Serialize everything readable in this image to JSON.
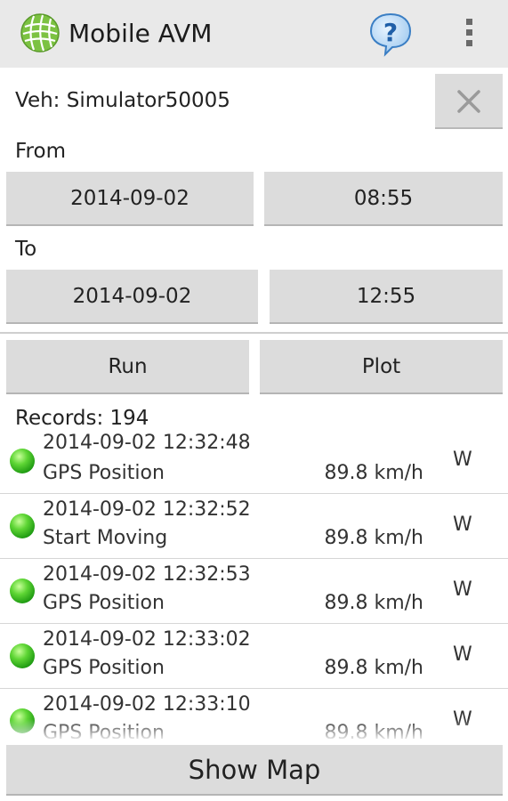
{
  "action_bar": {
    "title": "Mobile AVM",
    "app_icon": "globe-icon",
    "help_icon": "help-bubble-icon",
    "menu_icon": "overflow-menu-icon"
  },
  "vehicle": {
    "label": "Veh: Simulator50005",
    "clear_icon": "close-icon"
  },
  "from": {
    "label": "From",
    "date": "2014-09-02",
    "time": "08:55"
  },
  "to": {
    "label": "To",
    "date": "2014-09-02",
    "time": "12:55"
  },
  "actions": {
    "run": "Run",
    "plot": "Plot"
  },
  "records": {
    "count_label": "Records: 194",
    "status_color": "#3cc324",
    "items": [
      {
        "time": "2014-09-02 12:32:48",
        "event": "GPS Position",
        "speed": "89.8 km/h",
        "direction": "W"
      },
      {
        "time": "2014-09-02 12:32:52",
        "event": "Start Moving",
        "speed": "89.8 km/h",
        "direction": "W"
      },
      {
        "time": "2014-09-02 12:32:53",
        "event": "GPS Position",
        "speed": "89.8 km/h",
        "direction": "W"
      },
      {
        "time": "2014-09-02 12:33:02",
        "event": "GPS Position",
        "speed": "89.8 km/h",
        "direction": "W"
      },
      {
        "time": "2014-09-02 12:33:10",
        "event": "GPS Position",
        "speed": "89.8 km/h",
        "direction": "W"
      }
    ]
  },
  "footer": {
    "show_map": "Show Map"
  }
}
